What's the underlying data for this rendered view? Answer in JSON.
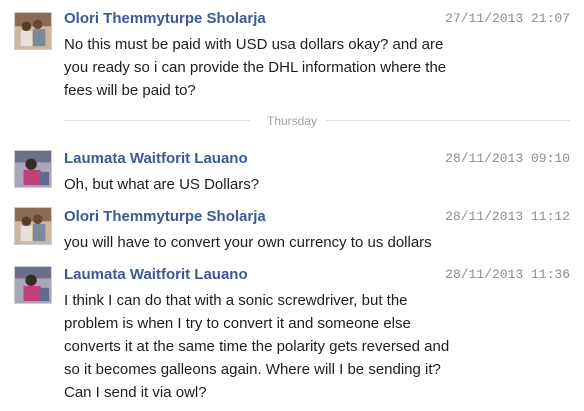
{
  "messages": [
    {
      "sender": "Olori Themmyturpe Sholarja",
      "timestamp": "27/11/2013 21:07",
      "text": "No this must be paid with USD usa dollars okay? and are\nyou ready so i can provide the DHL information where the\nfees will be paid to?"
    },
    {
      "sender": "Laumata Waitforit Lauano",
      "timestamp": "28/11/2013 09:10",
      "text": "Oh, but what are US Dollars?"
    },
    {
      "sender": "Olori Themmyturpe Sholarja",
      "timestamp": "28/11/2013 11:12",
      "text": "you will have to convert your own currency to us dollars"
    },
    {
      "sender": "Laumata Waitforit Lauano",
      "timestamp": "28/11/2013 11:36",
      "text": "I think I can do that with a sonic screwdriver, but the\nproblem is when I try to convert it and someone else\nconverts it at the same time the polarity gets reversed and\nso it becomes galleons again. Where will I be sending it?\nCan I send it via owl?"
    }
  ],
  "day_divider": "Thursday",
  "colors": {
    "sender_name": "#3b5998",
    "timestamp": "#8a8d94",
    "message_text": "#1c1e21",
    "divider_line": "#dfe1e5"
  }
}
